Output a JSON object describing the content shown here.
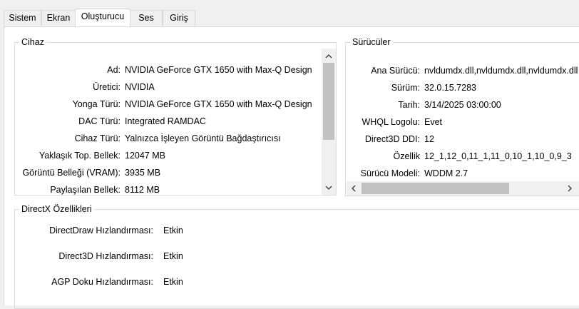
{
  "tabs": [
    {
      "label": "Sistem"
    },
    {
      "label": "Ekran"
    },
    {
      "label": "Oluşturucu"
    },
    {
      "label": "Ses"
    },
    {
      "label": "Giriş"
    }
  ],
  "device": {
    "title": "Cihaz",
    "rows": [
      {
        "label": "Ad:",
        "value": "NVIDIA GeForce GTX 1650 with Max-Q Design"
      },
      {
        "label": "Üretici:",
        "value": "NVIDIA"
      },
      {
        "label": "Yonga Türü:",
        "value": "NVIDIA GeForce GTX 1650 with Max-Q Design"
      },
      {
        "label": "DAC Türü:",
        "value": "Integrated RAMDAC"
      },
      {
        "label": "Cihaz Türü:",
        "value": "Yalnızca İşleyen Görüntü Bağdaştırıcısı"
      },
      {
        "label": "Yaklaşık Top. Bellek:",
        "value": "12047 MB"
      },
      {
        "label": "Görüntü Belleği (VRAM):",
        "value": "3935 MB"
      },
      {
        "label": "Paylaşılan Bellek:",
        "value": "8112 MB"
      }
    ]
  },
  "drivers": {
    "title": "Sürücüler",
    "rows": [
      {
        "label": "Ana Sürücü:",
        "value": "nvldumdx.dll,nvldumdx.dll,nvldumdx.dll"
      },
      {
        "label": "Sürüm:",
        "value": "32.0.15.7283"
      },
      {
        "label": "Tarih:",
        "value": "3/14/2025 03:00:00"
      },
      {
        "label": "WHQL Logolu:",
        "value": "Evet"
      },
      {
        "label": "Direct3D DDI:",
        "value": "12"
      },
      {
        "label": "Özellik",
        "value": "12_1,12_0,11_1,11_0,10_1,10_0,9_3"
      },
      {
        "label": "Sürücü Modeli:",
        "value": "WDDM 2.7"
      }
    ]
  },
  "directx": {
    "title": "DirectX Özellikleri",
    "rows": [
      {
        "label": "DirectDraw Hızlandırması:",
        "value": "Etkin"
      },
      {
        "label": "Direct3D Hızlandırması:",
        "value": "Etkin"
      },
      {
        "label": "AGP Doku Hızlandırması:",
        "value": "Etkin"
      }
    ]
  },
  "icons": {
    "scroll_up": "chevron-up-icon",
    "scroll_down": "chevron-down-icon",
    "scroll_left": "chevron-left-icon",
    "scroll_right": "chevron-right-icon"
  },
  "colors": {
    "panel": "#ffffff",
    "background": "#f0f0f0",
    "scroll_thumb": "#c2c2c2"
  }
}
